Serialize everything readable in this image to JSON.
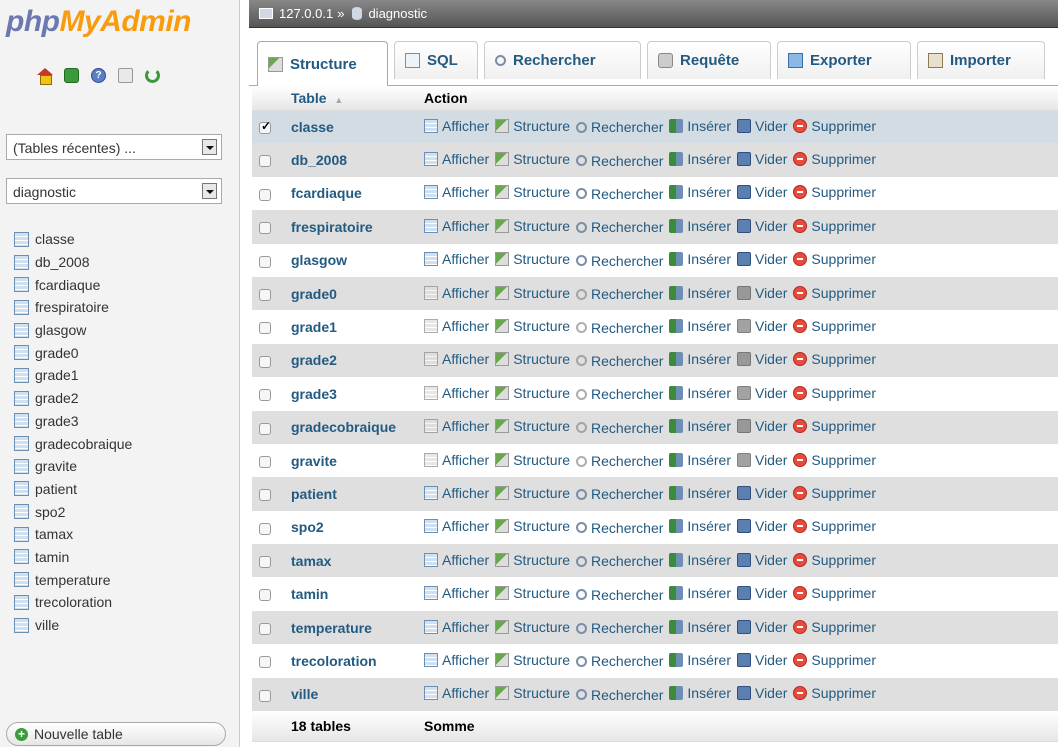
{
  "logo": {
    "part1": "php",
    "part2": "MyAdmin"
  },
  "nav": {
    "recent_tables": "(Tables récentes) ...",
    "database": "diagnostic",
    "tables": [
      "classe",
      "db_2008",
      "fcardiaque",
      "frespiratoire",
      "glasgow",
      "grade0",
      "grade1",
      "grade2",
      "grade3",
      "gradecobraique",
      "gravite",
      "patient",
      "spo2",
      "tamax",
      "tamin",
      "temperature",
      "trecoloration",
      "ville"
    ],
    "new_table": "Nouvelle table"
  },
  "breadcrumb": {
    "server": "127.0.0.1",
    "sep": "»",
    "database": "diagnostic"
  },
  "tabs": {
    "structure": "Structure",
    "sql": "SQL",
    "search": "Rechercher",
    "query": "Requête",
    "export": "Exporter",
    "import": "Importer"
  },
  "table": {
    "head_table": "Table",
    "head_sort": "▲",
    "head_action": "Action",
    "actions": {
      "browse": "Afficher",
      "structure": "Structure",
      "search": "Rechercher",
      "insert": "Insérer",
      "empty": "Vider",
      "drop": "Supprimer"
    },
    "rows": [
      {
        "name": "classe",
        "checked": true,
        "empty": false
      },
      {
        "name": "db_2008",
        "checked": false,
        "empty": false
      },
      {
        "name": "fcardiaque",
        "checked": false,
        "empty": false
      },
      {
        "name": "frespiratoire",
        "checked": false,
        "empty": false
      },
      {
        "name": "glasgow",
        "checked": false,
        "empty": false
      },
      {
        "name": "grade0",
        "checked": false,
        "empty": true
      },
      {
        "name": "grade1",
        "checked": false,
        "empty": true
      },
      {
        "name": "grade2",
        "checked": false,
        "empty": true
      },
      {
        "name": "grade3",
        "checked": false,
        "empty": true
      },
      {
        "name": "gradecobraique",
        "checked": false,
        "empty": true
      },
      {
        "name": "gravite",
        "checked": false,
        "empty": true
      },
      {
        "name": "patient",
        "checked": false,
        "empty": false
      },
      {
        "name": "spo2",
        "checked": false,
        "empty": false
      },
      {
        "name": "tamax",
        "checked": false,
        "empty": false
      },
      {
        "name": "tamin",
        "checked": false,
        "empty": false
      },
      {
        "name": "temperature",
        "checked": false,
        "empty": false
      },
      {
        "name": "trecoloration",
        "checked": false,
        "empty": false
      },
      {
        "name": "ville",
        "checked": false,
        "empty": false
      }
    ],
    "footer_count": "18 tables",
    "footer_sum": "Somme"
  }
}
